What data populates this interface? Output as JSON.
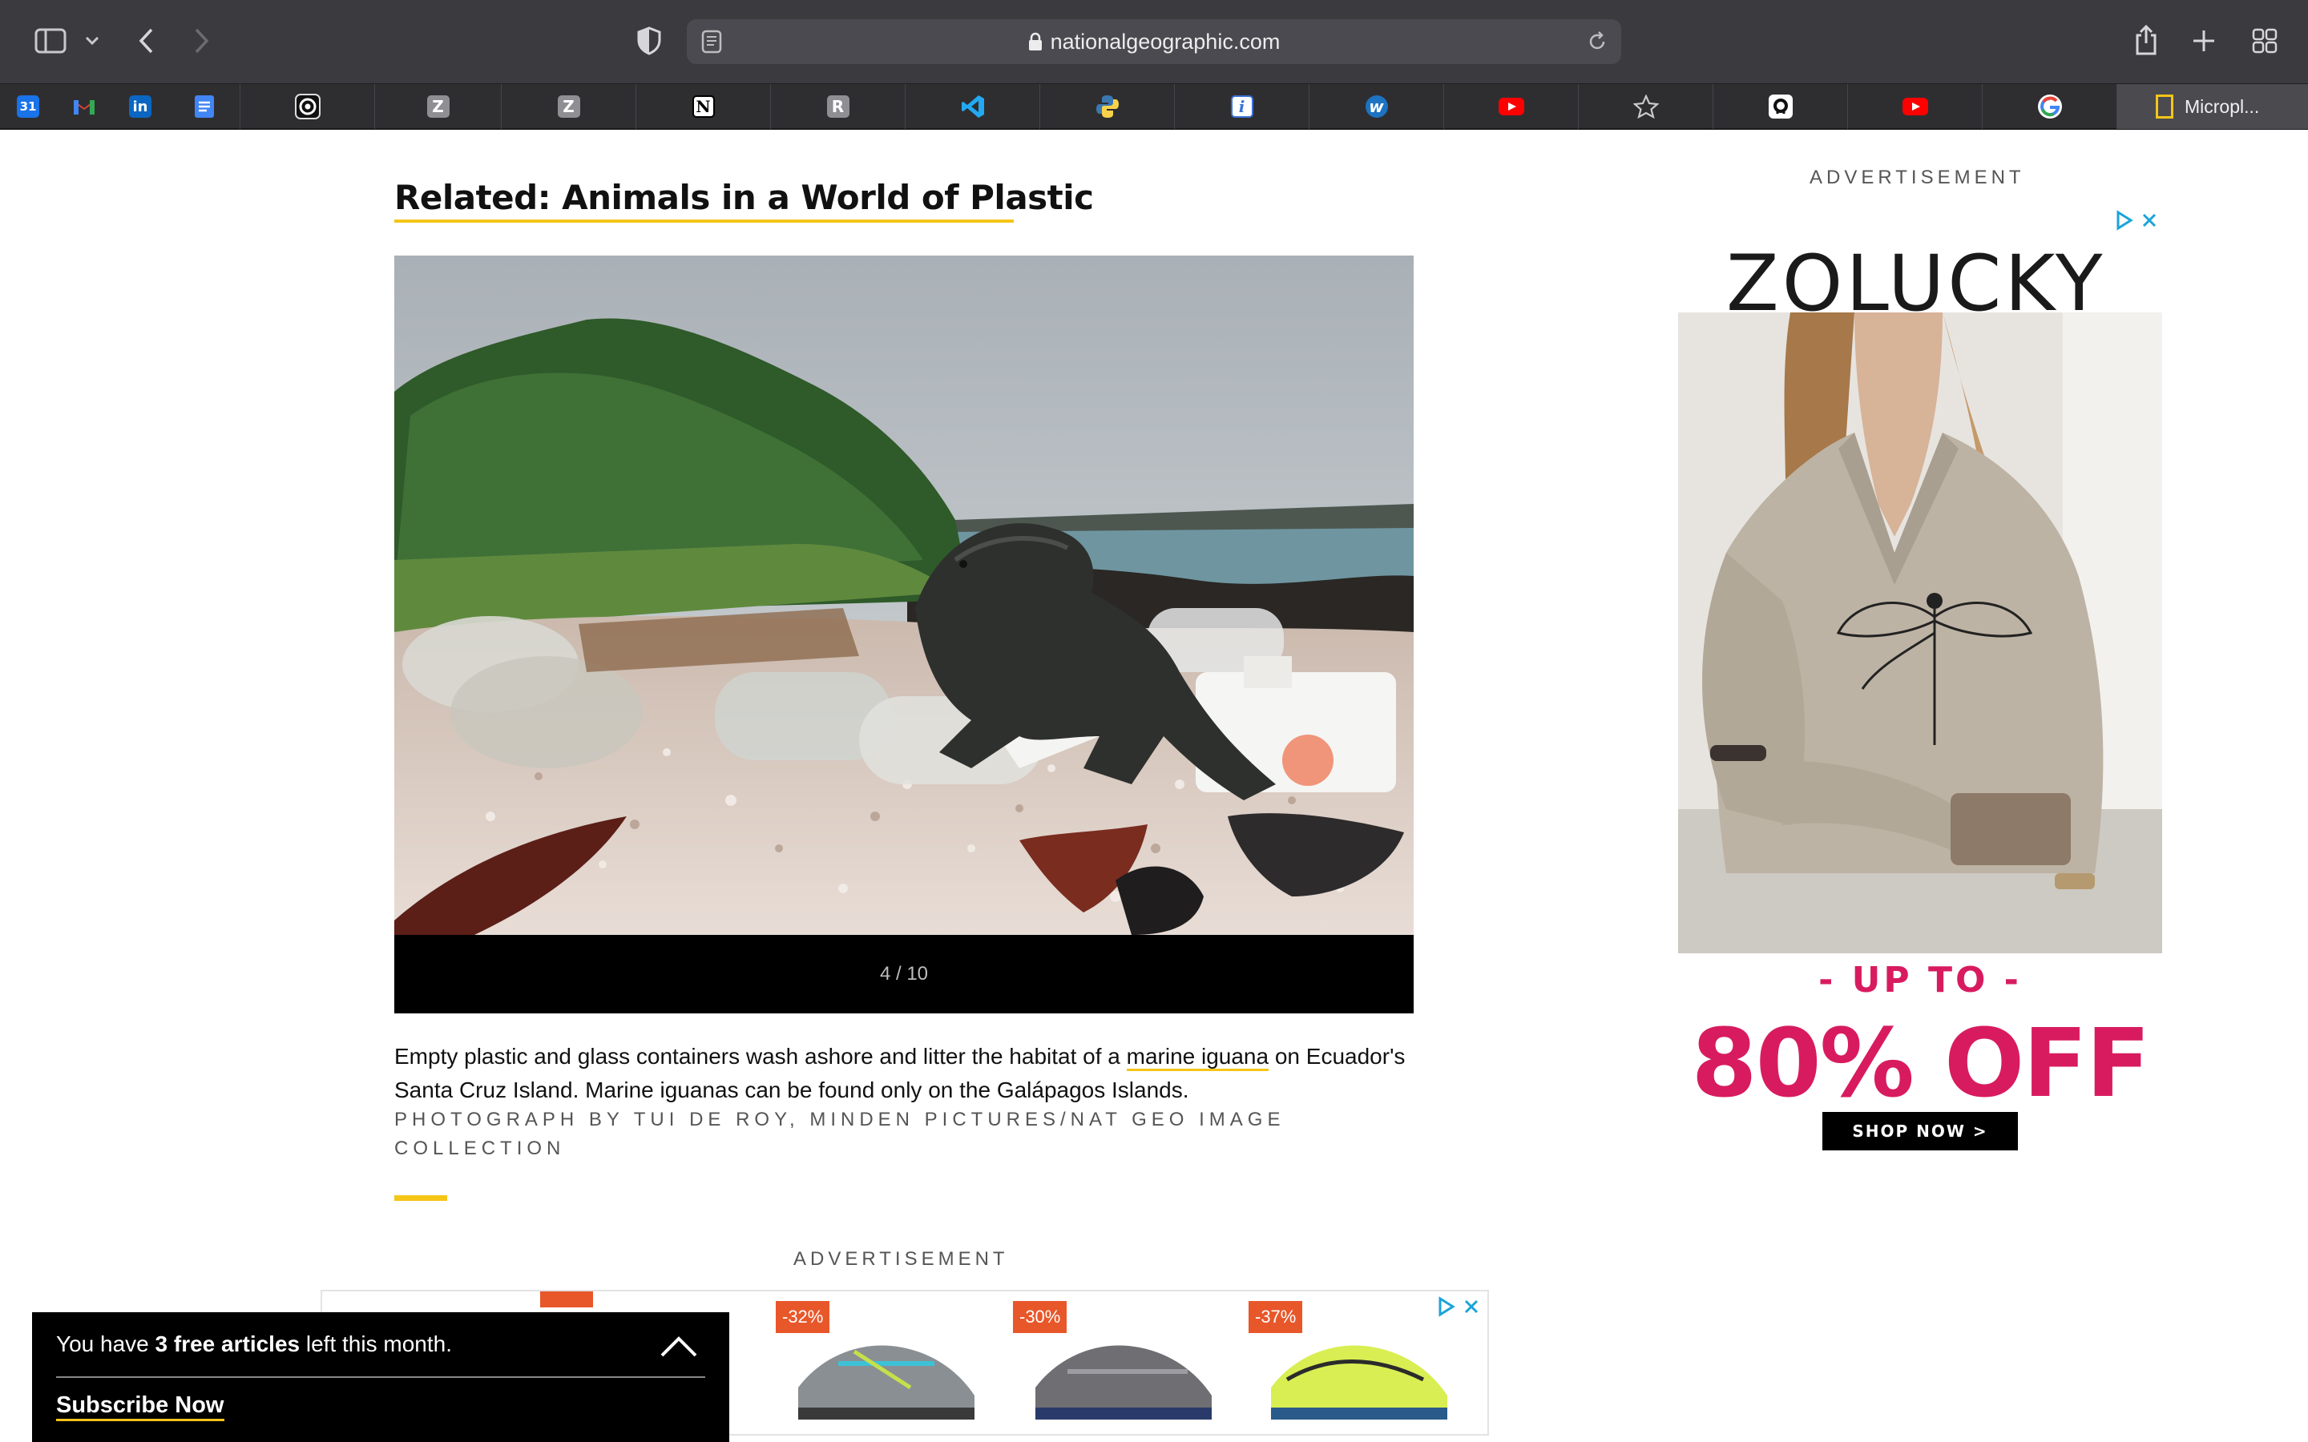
{
  "browser": {
    "url": "nationalgeographic.com",
    "active_tab_label": "Micropl...",
    "bookmarks": [
      "calendar-icon",
      "gmail-icon",
      "linkedin-icon",
      "docs-icon",
      "target-icon",
      "z-icon",
      "z-icon",
      "notion-icon",
      "r-icon",
      "vscode-icon",
      "python-icon",
      "info-icon",
      "w-icon",
      "youtube-icon",
      "star-icon",
      "github-icon",
      "youtube-icon",
      "google-icon"
    ],
    "calendar_day": "31",
    "z_letter": "Z",
    "r_letter": "R",
    "n_letter": "N",
    "i_letter": "i",
    "w_letter": "w"
  },
  "article": {
    "related_heading": "Related: Animals in a World of Plastic",
    "gallery_counter": "4 / 10",
    "caption_part1": "Empty plastic and glass containers wash ashore and litter the habitat of a ",
    "caption_link": "marine iguana",
    "caption_part2": " on Ecuador's Santa Cruz Island. Marine iguanas can be found only on the Galápagos Islands.",
    "credit": "PHOTOGRAPH BY TUI DE ROY, MINDEN PICTURES/NAT GEO IMAGE COLLECTION"
  },
  "ads": {
    "label": "ADVERTISEMENT",
    "side": {
      "brand": "ZOLUCKY",
      "up_to": "- UP TO -",
      "discount": "80% OFF",
      "cta": "SHOP NOW >"
    },
    "bottom": {
      "discounts": [
        "-32%",
        "-30%",
        "-37%"
      ]
    }
  },
  "paywall": {
    "prefix": "You have ",
    "count": "3 free articles",
    "suffix": " left this month.",
    "subscribe": "Subscribe Now"
  },
  "colors": {
    "accent_yellow": "#f5c518",
    "ad_pink": "#d81b5f",
    "discount_orange": "#e8572a"
  }
}
